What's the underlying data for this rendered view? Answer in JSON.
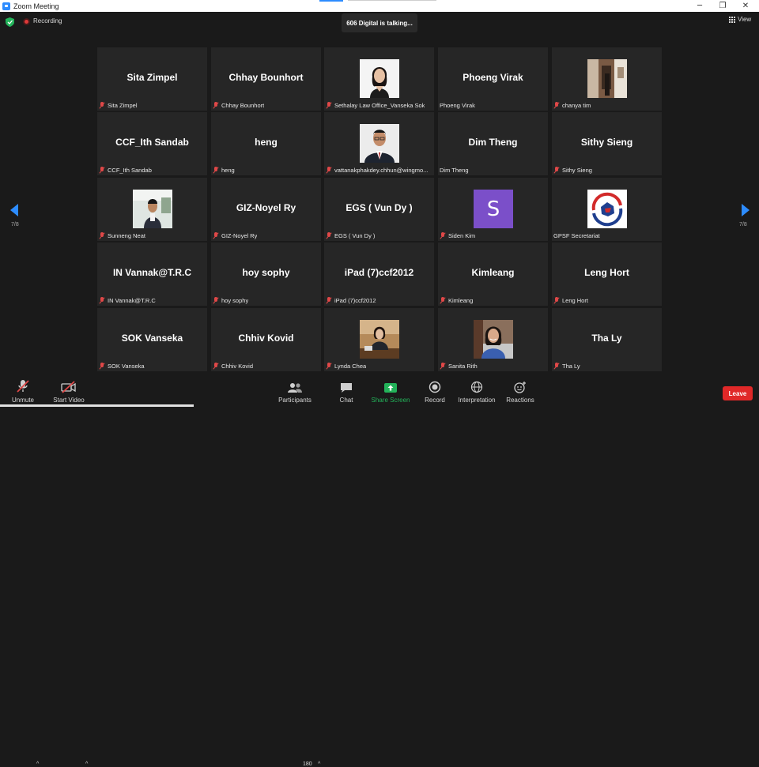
{
  "window": {
    "title": "Zoom Meeting",
    "minimize": "─",
    "restore": "❐",
    "close": "✕"
  },
  "topbar": {
    "recording_label": "Recording",
    "talking": "606 Digital is talking...",
    "view_label": "View"
  },
  "navigation": {
    "prev_page": "7/8",
    "next_page": "7/8"
  },
  "tiles": [
    {
      "big": "Sita Zimpel",
      "name": "Sita Zimpel",
      "muted": true
    },
    {
      "big": "Chhay Bounhort",
      "name": "Chhay Bounhort",
      "muted": true
    },
    {
      "big": "",
      "name": "Sethalay Law Office_Vanseka Sok",
      "muted": true,
      "photo": "woman-portrait"
    },
    {
      "big": "Phoeng Virak",
      "name": "Phoeng Virak",
      "muted": false
    },
    {
      "big": "",
      "name": "chanya tim",
      "muted": true,
      "photo": "room-photo"
    },
    {
      "big": "CCF_Ith Sandab",
      "name": "CCF_Ith Sandab",
      "muted": true
    },
    {
      "big": "heng",
      "name": "heng",
      "muted": true
    },
    {
      "big": "",
      "name": "vattanakphakdey.chhun@wingmo...",
      "muted": true,
      "photo": "man-portrait-glasses"
    },
    {
      "big": "Dim Theng",
      "name": "Dim Theng",
      "muted": false
    },
    {
      "big": "Sithy Sieng",
      "name": "Sithy Sieng",
      "muted": true
    },
    {
      "big": "",
      "name": "Sunneng Neat",
      "muted": true,
      "photo": "man-standing"
    },
    {
      "big": "GIZ-Noyel Ry",
      "name": "GIZ-Noyel Ry",
      "muted": true
    },
    {
      "big": "EGS ( Vun Dy )",
      "name": "EGS ( Vun Dy )",
      "muted": true
    },
    {
      "big": "",
      "name": "Siden Kim",
      "muted": true,
      "avatar_letter": "S",
      "avatar_color": "#7b4fc9"
    },
    {
      "big": "",
      "name": "GPSF Secretariat",
      "muted": false,
      "photo": "gpsf-logo"
    },
    {
      "big": "IN Vannak@T.R.C",
      "name": "IN Vannak@T.R.C",
      "muted": true
    },
    {
      "big": "hoy sophy",
      "name": "hoy sophy",
      "muted": true
    },
    {
      "big": "iPad (7)ccf2012",
      "name": "iPad (7)ccf2012",
      "muted": true
    },
    {
      "big": "Kimleang",
      "name": "Kimleang",
      "muted": true
    },
    {
      "big": "Leng Hort",
      "name": "Leng Hort",
      "muted": true
    },
    {
      "big": "SOK Vanseka",
      "name": "SOK Vanseka",
      "muted": true
    },
    {
      "big": "Chhiv Kovid",
      "name": "Chhiv Kovid",
      "muted": true
    },
    {
      "big": "",
      "name": "Lynda Chea",
      "muted": true,
      "photo": "woman-desk"
    },
    {
      "big": "",
      "name": "Sanita Rith",
      "muted": true,
      "photo": "woman-smiling"
    },
    {
      "big": "Tha Ly",
      "name": "Tha Ly",
      "muted": true
    }
  ],
  "toolbar": {
    "unmute": "Unmute",
    "start_video": "Start Video",
    "participants": "Participants",
    "participant_count": "180",
    "chat": "Chat",
    "share_screen": "Share Screen",
    "record": "Record",
    "interpretation": "Interpretation",
    "reactions": "Reactions",
    "leave": "Leave",
    "share_color": "#23b35a",
    "leave_color": "#e02828"
  }
}
